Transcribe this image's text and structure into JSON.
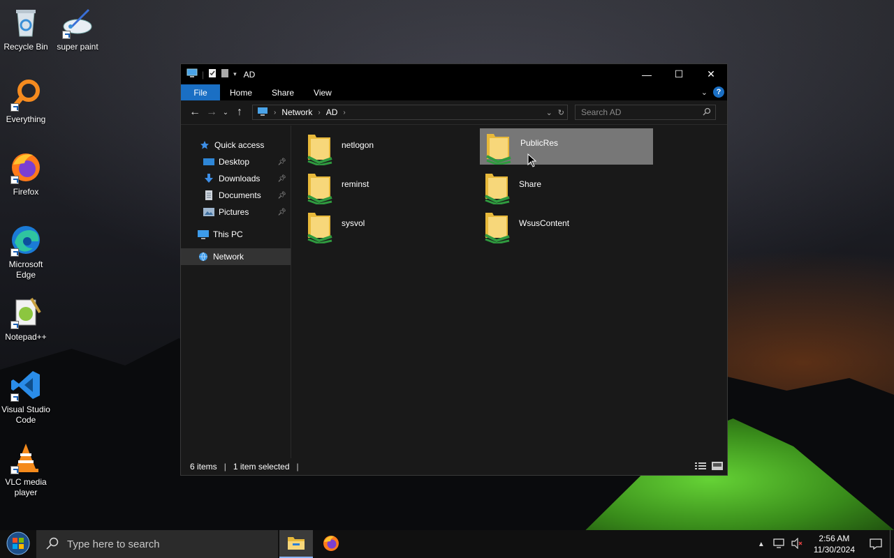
{
  "desktop": {
    "icons": [
      {
        "label": "Recycle Bin",
        "icon": "recycle-bin-icon"
      },
      {
        "label": "super paint",
        "icon": "paint-icon"
      },
      {
        "label": "Everything",
        "icon": "search-magnifier-icon"
      },
      {
        "label": "Firefox",
        "icon": "firefox-icon"
      },
      {
        "label": "Microsoft Edge",
        "icon": "edge-icon"
      },
      {
        "label": "Notepad++",
        "icon": "notepadpp-icon"
      },
      {
        "label": "Visual Studio Code",
        "icon": "vscode-icon"
      },
      {
        "label": "VLC media player",
        "icon": "vlc-icon"
      }
    ]
  },
  "window": {
    "title": "AD",
    "controls": {
      "minimize": "—",
      "maximize": "☐",
      "close": "✕"
    },
    "ribbon_tabs": [
      "File",
      "Home",
      "Share",
      "View"
    ],
    "help": "?",
    "address": {
      "segments": [
        "Network",
        "AD"
      ]
    },
    "search": {
      "placeholder": "Search AD"
    },
    "sidebar": {
      "items": [
        {
          "label": "Quick access",
          "icon": "star-icon"
        },
        {
          "label": "Desktop",
          "icon": "desktop-icon",
          "pinned": true
        },
        {
          "label": "Downloads",
          "icon": "download-icon",
          "pinned": true
        },
        {
          "label": "Documents",
          "icon": "document-icon",
          "pinned": true
        },
        {
          "label": "Pictures",
          "icon": "pictures-icon",
          "pinned": true
        },
        {
          "label": "This PC",
          "icon": "pc-icon"
        },
        {
          "label": "Network",
          "icon": "network-icon",
          "selected": true
        }
      ]
    },
    "folders": [
      {
        "name": "netlogon"
      },
      {
        "name": "PublicRes",
        "selected": true
      },
      {
        "name": "reminst"
      },
      {
        "name": "Share"
      },
      {
        "name": "sysvol"
      },
      {
        "name": "WsusContent"
      }
    ],
    "status": {
      "items": "6 items",
      "selected": "1 item selected"
    }
  },
  "taskbar": {
    "search_placeholder": "Type here to search",
    "time": "2:56 AM",
    "date": "11/30/2024"
  },
  "colors": {
    "accent": "#1a6fc4",
    "folder": "#f4c542",
    "share_badge": "#3fa34d"
  }
}
